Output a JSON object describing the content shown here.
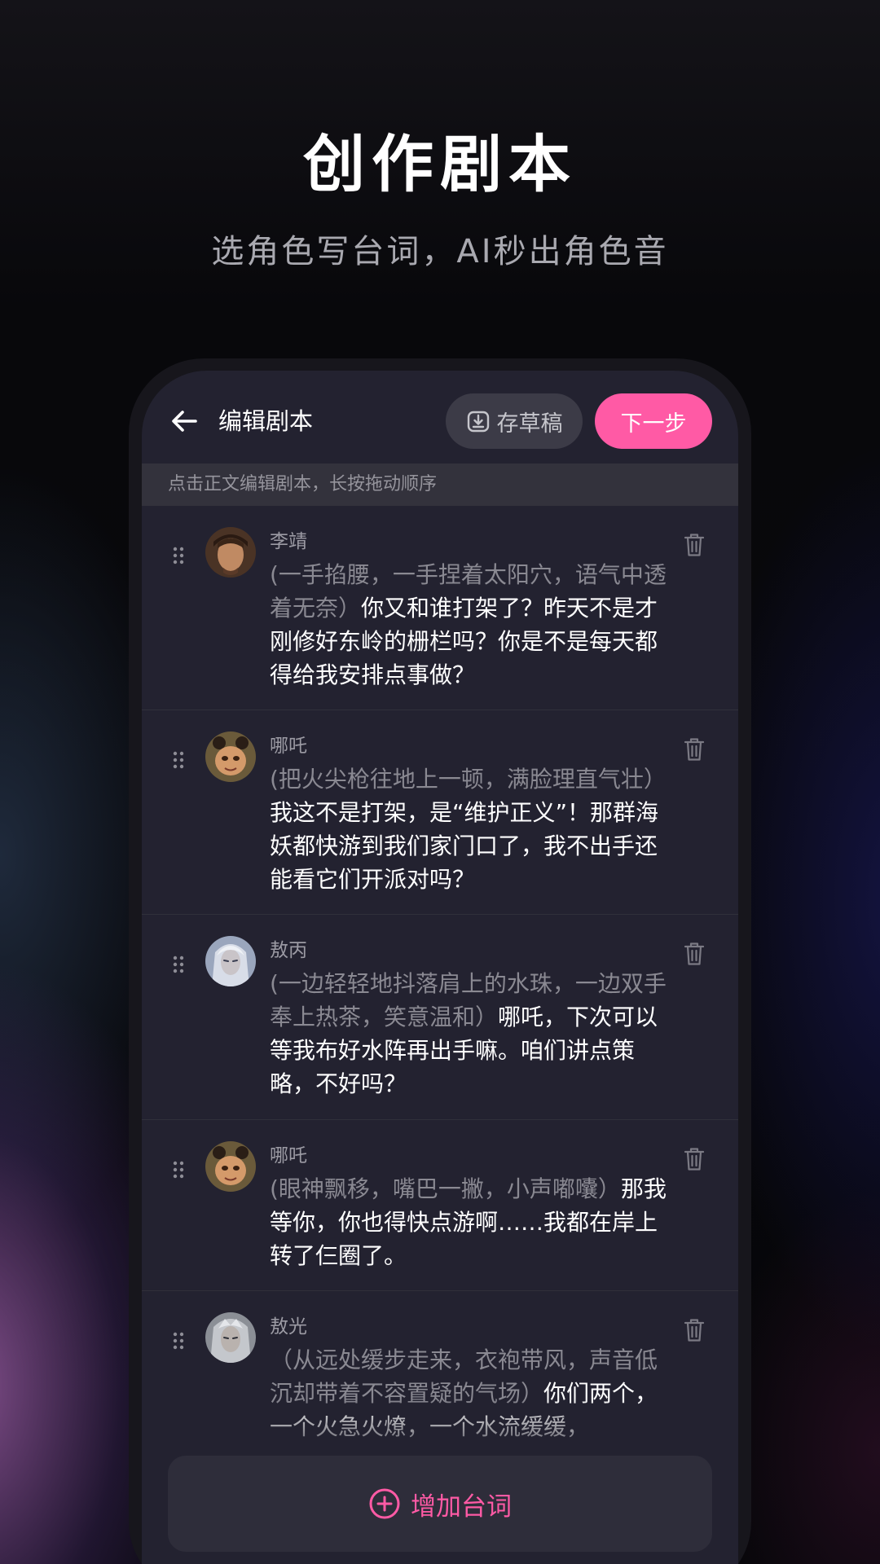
{
  "promo": {
    "headline": "创作剧本",
    "subline": "选角色写台词，AI秒出角色音"
  },
  "appbar": {
    "title": "编辑剧本",
    "draft_label": "存草稿",
    "next_label": "下一步"
  },
  "hint": "点击正文编辑剧本，长按拖动顺序",
  "lines": [
    {
      "role": "李靖",
      "stage": "(一手掐腰，一手捏着太阳穴，语气中透着无奈）",
      "text": "你又和谁打架了？昨天不是才刚修好东岭的栅栏吗？你是不是每天都得给我安排点事做？"
    },
    {
      "role": "哪吒",
      "stage": "(把火尖枪往地上一顿，满脸理直气壮）",
      "text": "我这不是打架，是“维护正义”！那群海妖都快游到我们家门口了，我不出手还能看它们开派对吗？"
    },
    {
      "role": "敖丙",
      "stage": "(一边轻轻地抖落肩上的水珠，一边双手奉上热茶，笑意温和）",
      "text": "哪吒，下次可以等我布好水阵再出手嘛。咱们讲点策略，不好吗？"
    },
    {
      "role": "哪吒",
      "stage": "(眼神飘移，嘴巴一撇，小声嘟囔）",
      "text": "那我等你，你也得快点游啊……我都在岸上转了仨圈了。"
    },
    {
      "role": "敖光",
      "stage": "（从远处缓步走来，衣袍带风，声音低沉却带着不容置疑的气场）",
      "text": "你们两个，一个火急火燎，一个水流缓缓，"
    }
  ],
  "add_label": "增加台词",
  "colors": {
    "accent": "#ff5aa5",
    "screen_bg": "#232230"
  }
}
